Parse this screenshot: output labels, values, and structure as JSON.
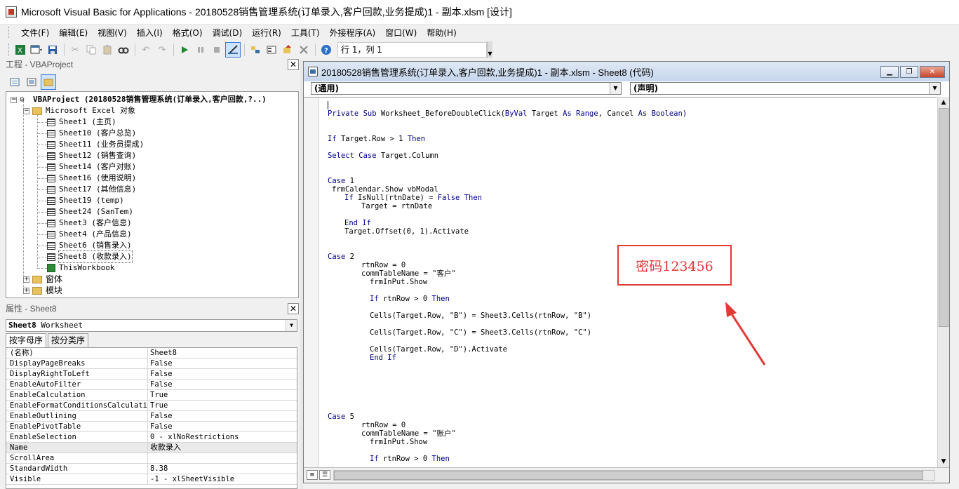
{
  "window": {
    "title": "Microsoft Visual Basic for Applications - 20180528销售管理系统(订单录入,客户回款,业务提成)1 - 副本.xlsm [设计]"
  },
  "menu": {
    "items": [
      "文件(F)",
      "编辑(E)",
      "视图(V)",
      "插入(I)",
      "格式(O)",
      "调试(D)",
      "运行(R)",
      "工具(T)",
      "外接程序(A)",
      "窗口(W)",
      "帮助(H)"
    ]
  },
  "toolbar": {
    "status": "行 1，列 1",
    "icons": [
      "excel-icon",
      "insert-userform-icon",
      "save-icon",
      "cut-icon",
      "copy-icon",
      "paste-icon",
      "find-icon",
      "undo-icon",
      "redo-icon",
      "run-icon",
      "break-icon",
      "reset-icon",
      "design-mode-icon",
      "project-explorer-icon",
      "properties-window-icon",
      "object-browser-icon",
      "toolbox-icon",
      "help-icon"
    ]
  },
  "project_panel": {
    "title": "工程 - VBAProject",
    "root": "VBAProject (20180528销售管理系统(订单录入,客户回款,?..)",
    "folder_objects": "Microsoft Excel 对象",
    "sheets": [
      "Sheet1 (主页)",
      "Sheet10 (客户总览)",
      "Sheet11 (业务员提成)",
      "Sheet12 (销售查询)",
      "Sheet14 (客户对账)",
      "Sheet16 (使用说明)",
      "Sheet17 (其他信息)",
      "Sheet19 (temp)",
      "Sheet24 (SanTem)",
      "Sheet3 (客户信息)",
      "Sheet4 (产品信息)",
      "Sheet6 (销售录入)",
      "Sheet8 (收款录入)"
    ],
    "workbook": "ThisWorkbook",
    "folder_forms": "窗体",
    "folder_modules": "模块"
  },
  "properties_panel": {
    "title": "属性 - Sheet8",
    "object_name": "Sheet8",
    "object_type": "Worksheet",
    "tab_alpha": "按字母序",
    "tab_category": "按分类序",
    "rows": [
      {
        "key": "(名称)",
        "value": "Sheet8"
      },
      {
        "key": "DisplayPageBreaks",
        "value": "False"
      },
      {
        "key": "DisplayRightToLeft",
        "value": "False"
      },
      {
        "key": "EnableAutoFilter",
        "value": "False"
      },
      {
        "key": "EnableCalculation",
        "value": "True"
      },
      {
        "key": "EnableFormatConditionsCalculation",
        "value": "True"
      },
      {
        "key": "EnableOutlining",
        "value": "False"
      },
      {
        "key": "EnablePivotTable",
        "value": "False"
      },
      {
        "key": "EnableSelection",
        "value": "0 - xlNoRestrictions"
      },
      {
        "key": "Name",
        "value": "收款录入"
      },
      {
        "key": "ScrollArea",
        "value": ""
      },
      {
        "key": "StandardWidth",
        "value": "8.38"
      },
      {
        "key": "Visible",
        "value": "-1 - xlSheetVisible"
      }
    ]
  },
  "code_window": {
    "title": "20180528销售管理系统(订单录入,客户回款,业务提成)1 - 副本.xlsm - Sheet8 (代码)",
    "object_combo": "(通用)",
    "proc_combo": "(声明)",
    "lines": [
      {
        "indent": 0,
        "text": "Private Sub Worksheet_BeforeDoubleClick(ByVal Target As Range, Cancel As Boolean)"
      },
      {
        "indent": 0,
        "text": ""
      },
      {
        "indent": 0,
        "text": ""
      },
      {
        "indent": 0,
        "text": "If Target.Row > 1 Then"
      },
      {
        "indent": 0,
        "text": ""
      },
      {
        "indent": 0,
        "text": "Select Case Target.Column"
      },
      {
        "indent": 0,
        "text": ""
      },
      {
        "indent": 0,
        "text": ""
      },
      {
        "indent": 0,
        "text": "Case 1"
      },
      {
        "indent": 1,
        "text": "frmCalendar.Show vbModal"
      },
      {
        "indent": 4,
        "text": "If IsNull(rtnDate) = False Then"
      },
      {
        "indent": 8,
        "text": "Target = rtnDate"
      },
      {
        "indent": 0,
        "text": ""
      },
      {
        "indent": 4,
        "text": "End If"
      },
      {
        "indent": 4,
        "text": "Target.Offset(0, 1).Activate"
      },
      {
        "indent": 0,
        "text": ""
      },
      {
        "indent": 0,
        "text": ""
      },
      {
        "indent": 0,
        "text": "Case 2"
      },
      {
        "indent": 8,
        "text": "rtnRow = 0"
      },
      {
        "indent": 8,
        "text": "commTableName = \"客户\""
      },
      {
        "indent": 10,
        "text": "frmInPut.Show"
      },
      {
        "indent": 0,
        "text": ""
      },
      {
        "indent": 10,
        "text": "If rtnRow > 0 Then"
      },
      {
        "indent": 0,
        "text": ""
      },
      {
        "indent": 10,
        "text": "Cells(Target.Row, \"B\") = Sheet3.Cells(rtnRow, \"B\")"
      },
      {
        "indent": 0,
        "text": ""
      },
      {
        "indent": 10,
        "text": "Cells(Target.Row, \"C\") = Sheet3.Cells(rtnRow, \"C\")"
      },
      {
        "indent": 0,
        "text": ""
      },
      {
        "indent": 10,
        "text": "Cells(Target.Row, \"D\").Activate"
      },
      {
        "indent": 10,
        "text": "End If"
      },
      {
        "indent": 0,
        "text": ""
      },
      {
        "indent": 0,
        "text": ""
      },
      {
        "indent": 0,
        "text": ""
      },
      {
        "indent": 0,
        "text": ""
      },
      {
        "indent": 0,
        "text": ""
      },
      {
        "indent": 0,
        "text": ""
      },
      {
        "indent": 0,
        "text": "Case 5"
      },
      {
        "indent": 8,
        "text": "rtnRow = 0"
      },
      {
        "indent": 8,
        "text": "commTableName = \"账户\""
      },
      {
        "indent": 10,
        "text": "frmInPut.Show"
      },
      {
        "indent": 0,
        "text": ""
      },
      {
        "indent": 10,
        "text": "If rtnRow > 0 Then"
      }
    ]
  },
  "annotation": {
    "text": "密码123456",
    "color": "#e23a36"
  }
}
